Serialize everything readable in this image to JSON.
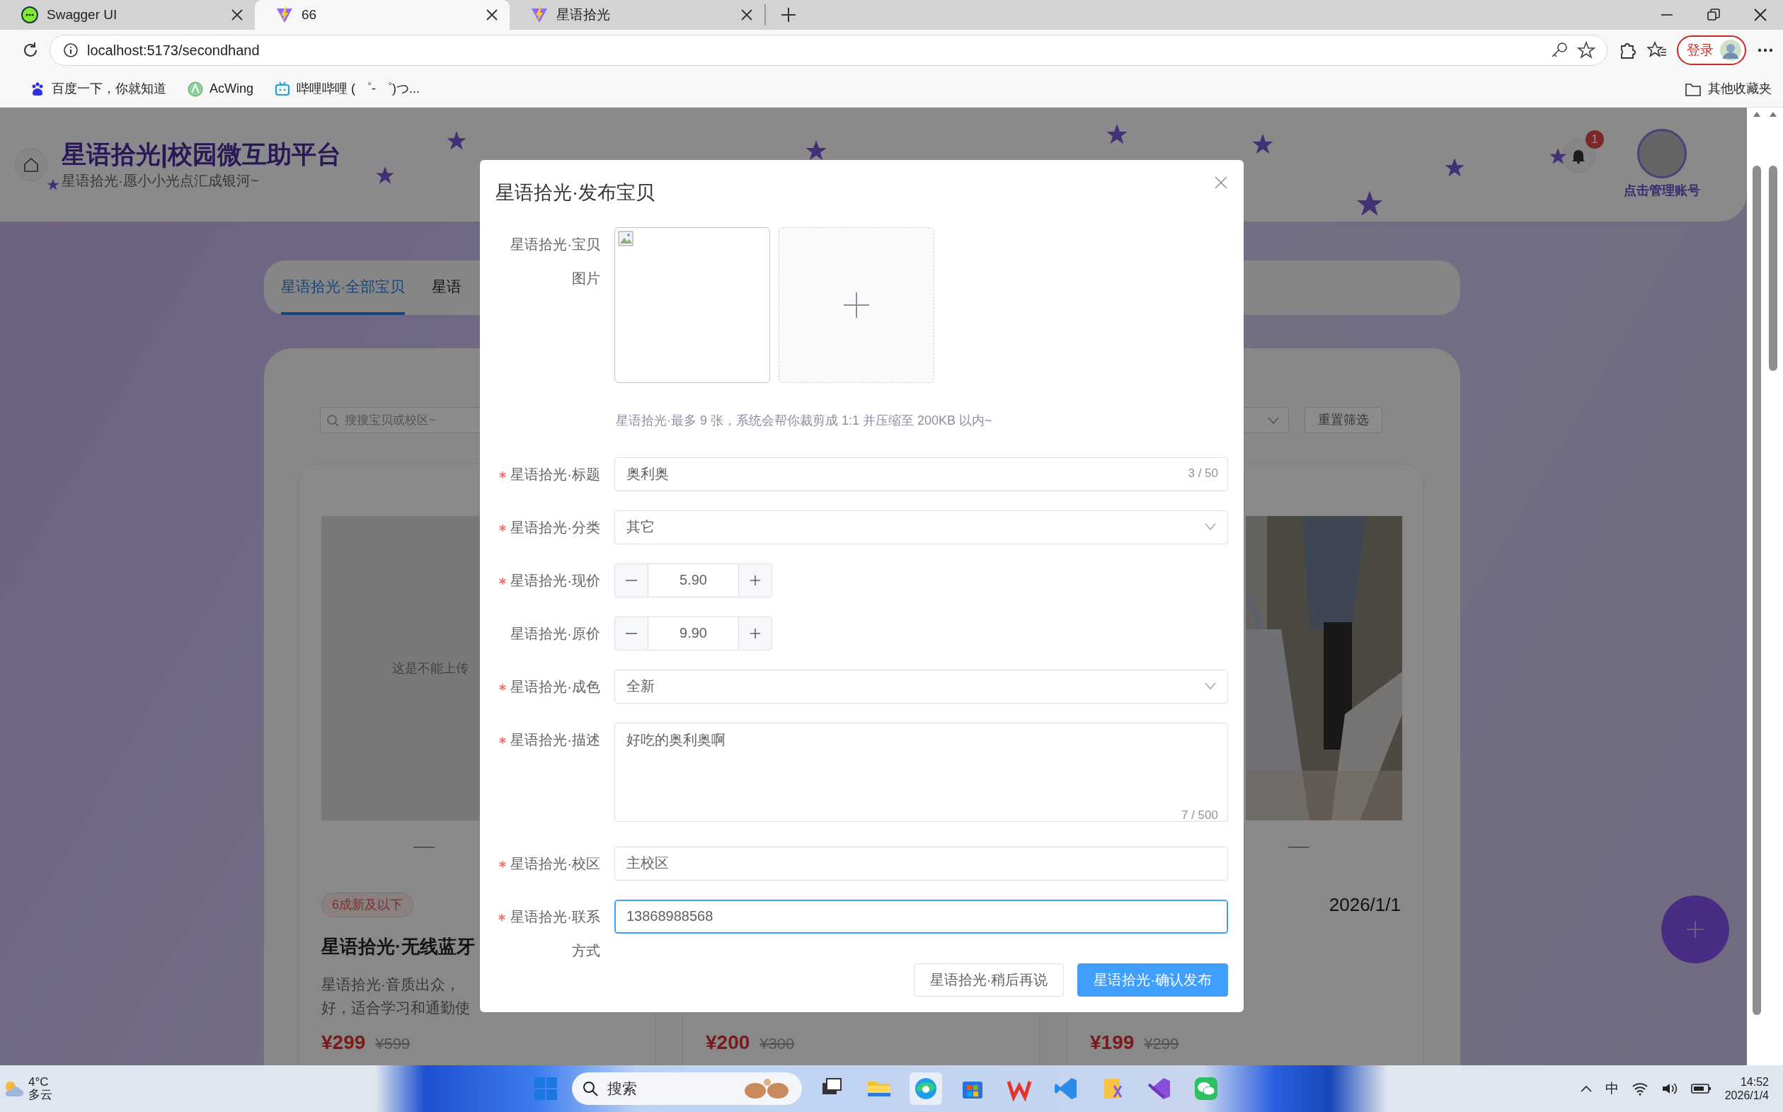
{
  "browser": {
    "tabs": [
      {
        "title": "Swagger UI",
        "kind": "swagger",
        "selected": false
      },
      {
        "title": "66",
        "kind": "vite",
        "selected": true
      },
      {
        "title": "星语拾光",
        "kind": "vite",
        "selected": false
      }
    ],
    "address": "localhost:5173/secondhand",
    "profile_button": "登录",
    "bookmarks": [
      {
        "label": "百度一下，你就知道",
        "kind": "baidu"
      },
      {
        "label": "AcWing",
        "kind": "acwing"
      },
      {
        "label": "哔哩哔哩 ( ゜- ゜)つ...",
        "kind": "bilibili"
      }
    ],
    "other_bookmarks": "其他收藏夹"
  },
  "page": {
    "title": "星语拾光|校园微互助平台",
    "subtitle": "星语拾光·愿小小光点汇成银河~",
    "notification_count": "1",
    "account_label": "点击管理账号",
    "tabs": [
      {
        "label": "星语拾光·全部宝贝",
        "selected": true
      },
      {
        "label": "星语",
        "selected": false
      }
    ],
    "search_placeholder": "搜搜宝贝或校区~",
    "reset_button": "重置筛选",
    "cards": [
      {
        "image": {
          "kind": "placeholder",
          "text": "这是不能上传"
        },
        "tag": "6成新及以下",
        "title": "星语拾光·无线蓝牙",
        "description": [
          "星语拾光·音质出众，",
          "好，适合学习和通勤使"
        ],
        "price": "¥299",
        "original_price": "¥599"
      },
      {
        "price": "¥200",
        "original_price": "¥300"
      },
      {
        "date": "2026/1/1",
        "price": "¥199",
        "original_price": "¥299"
      }
    ]
  },
  "dialog": {
    "title": "星语拾光·发布宝贝",
    "image_label": "星语拾光·宝贝图片",
    "hint": "星语拾光·最多 9 张，系统会帮你裁剪成 1:1 并压缩至 200KB 以内~",
    "fields": [
      {
        "kind": "text",
        "label": "星语拾光·标题",
        "required": true,
        "value": "奥利奥",
        "counter": "3 / 50",
        "focused": false
      },
      {
        "kind": "select",
        "label": "星语拾光·分类",
        "required": true,
        "value": "其它",
        "focused": false
      },
      {
        "kind": "number",
        "label": "星语拾光·现价",
        "required": true,
        "value": "5.90",
        "focused": false
      },
      {
        "kind": "number",
        "label": "星语拾光·原价",
        "required": false,
        "value": "9.90",
        "focused": false
      },
      {
        "kind": "select",
        "label": "星语拾光·成色",
        "required": true,
        "value": "全新",
        "focused": false
      },
      {
        "kind": "textarea",
        "label": "星语拾光·描述",
        "required": true,
        "value": "好吃的奥利奥啊",
        "counter": "7 / 500",
        "focused": false
      },
      {
        "kind": "text",
        "label": "星语拾光·校区",
        "required": true,
        "value": "主校区",
        "focused": false
      },
      {
        "kind": "text",
        "label": "星语拾光·联系方式",
        "required": true,
        "value": "13868988568",
        "focused": true
      }
    ],
    "buttons": [
      {
        "label": "星语拾光·稍后再说",
        "kind": "secondary"
      },
      {
        "label": "星语拾光·确认发布",
        "kind": "primary"
      }
    ]
  },
  "taskbar": {
    "temperature": "4°C",
    "weather": "多云",
    "search_placeholder": "搜索",
    "input_method": "中",
    "time": "14:52",
    "date": "2026/1/4"
  }
}
